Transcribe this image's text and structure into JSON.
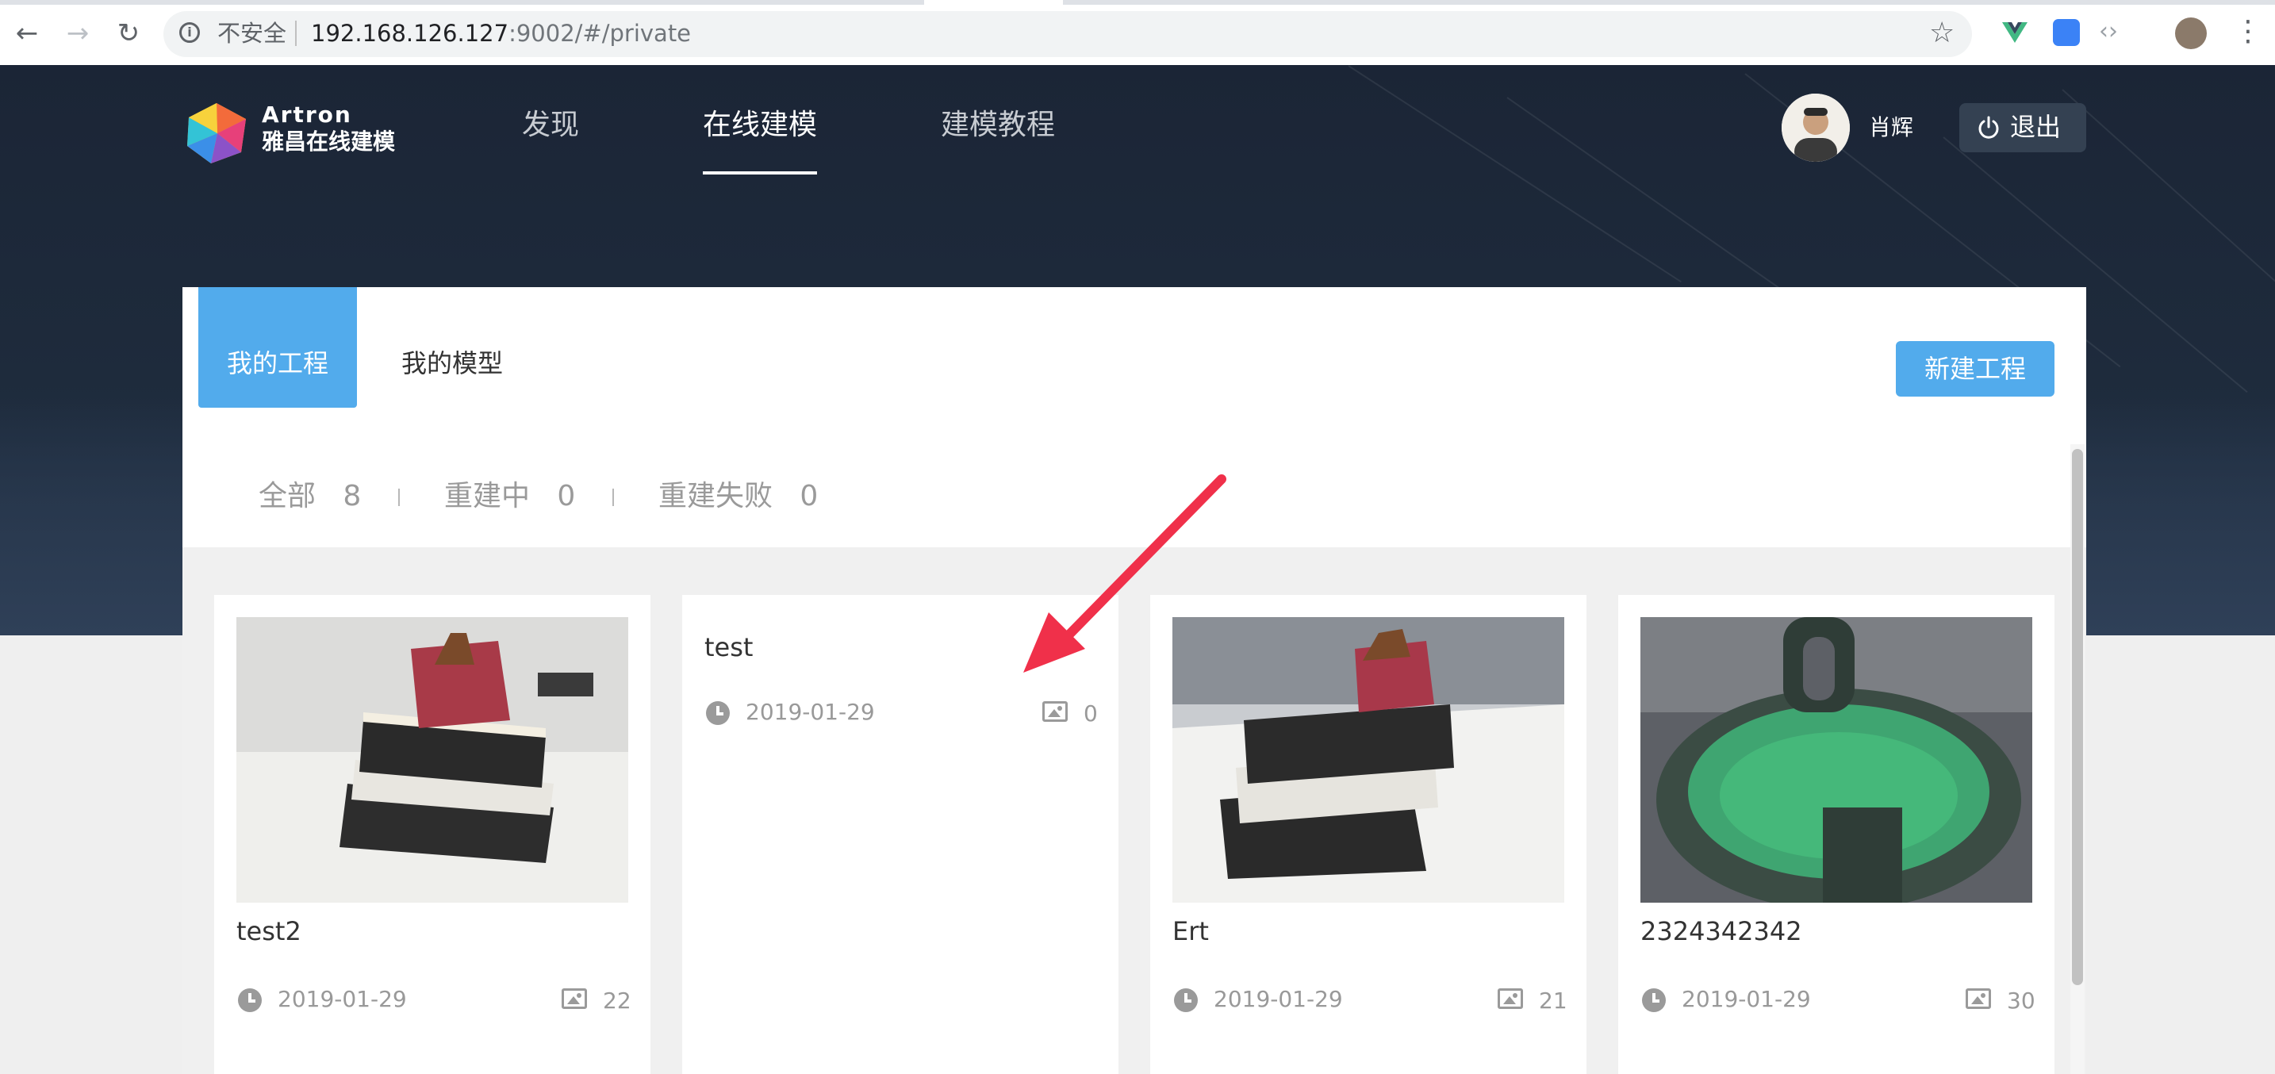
{
  "browser": {
    "insecure_label": "不安全",
    "url_host": "192.168.126.127",
    "url_rest": ":9002/#/private"
  },
  "header": {
    "brand_en": "Artron",
    "brand_cn": "雅昌在线建模",
    "nav": [
      "发现",
      "在线建模",
      "建模教程"
    ],
    "active_nav": "在线建模",
    "user_name": "肖辉",
    "logout_label": "退出"
  },
  "tabs": {
    "my_projects": "我的工程",
    "my_models": "我的模型"
  },
  "new_project_label": "新建工程",
  "filters": [
    {
      "label": "全部",
      "count": "8"
    },
    {
      "label": "重建中",
      "count": "0"
    },
    {
      "label": "重建失败",
      "count": "0"
    }
  ],
  "cards": [
    {
      "title": "test2",
      "date": "2019-01-29",
      "images": "22"
    },
    {
      "title": "test",
      "date": "2019-01-29",
      "images": "0"
    },
    {
      "title": "Ert",
      "date": "2019-01-29",
      "images": "21"
    },
    {
      "title": "2324342342",
      "date": "2019-01-29",
      "images": "30"
    }
  ],
  "colors": {
    "accent": "#52abec",
    "hero_bg": "#1e2b3c",
    "arrow": "#f0304a"
  }
}
